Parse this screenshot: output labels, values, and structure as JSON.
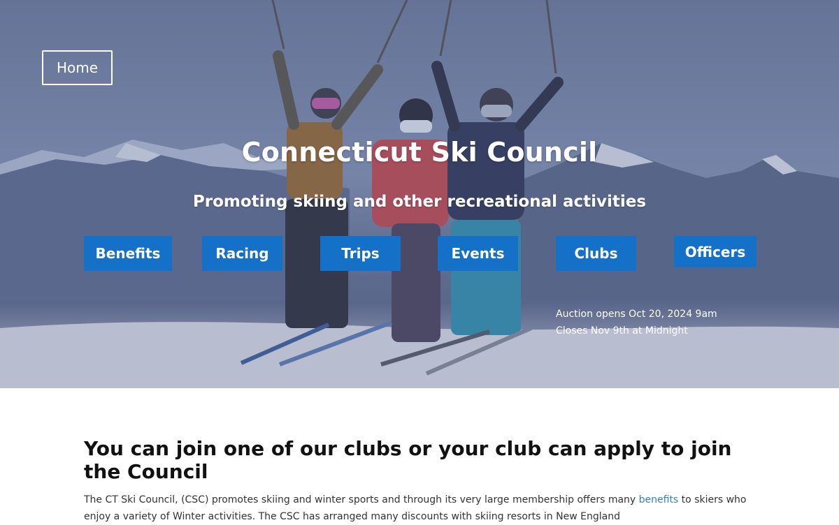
{
  "nav": {
    "home_label": "Home",
    "buttons": [
      {
        "label": "Benefits"
      },
      {
        "label": "Racing"
      },
      {
        "label": "Trips"
      },
      {
        "label": "Events"
      },
      {
        "label": "Clubs"
      },
      {
        "label": "Officers"
      }
    ]
  },
  "hero": {
    "title": "Connecticut Ski Council",
    "subtitle": "Promoting skiing and other recreational activities",
    "auction_line1": "Auction opens Oct 20, 2024 9am",
    "auction_line2": "Closes Nov 9th at Midnight"
  },
  "main": {
    "heading": "You can join one of our clubs or your club can apply to join the Council",
    "para_before_link": "The CT Ski Council, (CSC) promotes skiing and winter sports and through its very large membership offers many ",
    "link_text": "benefits",
    "para_after_link": " to skiers who enjoy a variety of Winter activities.  The CSC has arranged many discounts with skiing resorts in New England"
  },
  "colors": {
    "nav_button": "#1570c8",
    "link": "#2f80c7",
    "hero_overlay": "#505f8c"
  }
}
